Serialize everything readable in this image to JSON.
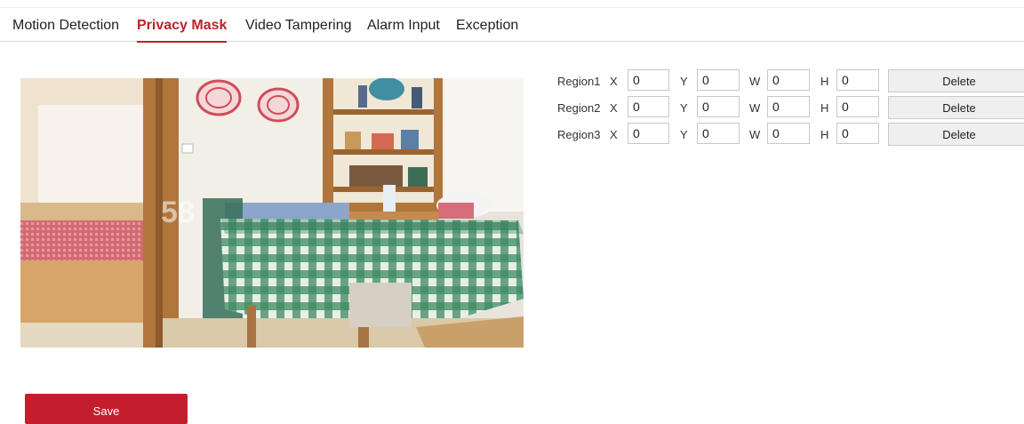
{
  "tabs": [
    {
      "label": "Motion Detection",
      "active": false
    },
    {
      "label": "Privacy Mask",
      "active": true
    },
    {
      "label": "Video Tampering",
      "active": false
    },
    {
      "label": "Alarm Input",
      "active": false
    },
    {
      "label": "Exception",
      "active": false
    }
  ],
  "preview": {
    "watermark": "58",
    "colors": {
      "wall": "#f2efe6",
      "wood": "#b0763c",
      "tablecloth_green": "#2f7a55",
      "floor": "#d9c9a8"
    }
  },
  "regions": [
    {
      "label": "Region1",
      "x_label": "X",
      "x": "0",
      "y_label": "Y",
      "y": "0",
      "w_label": "W",
      "w": "0",
      "h_label": "H",
      "h": "0",
      "delete_label": "Delete"
    },
    {
      "label": "Region2",
      "x_label": "X",
      "x": "0",
      "y_label": "Y",
      "y": "0",
      "w_label": "W",
      "w": "0",
      "h_label": "H",
      "h": "0",
      "delete_label": "Delete"
    },
    {
      "label": "Region3",
      "x_label": "X",
      "x": "0",
      "y_label": "Y",
      "y": "0",
      "w_label": "W",
      "w": "0",
      "h_label": "H",
      "h": "0",
      "delete_label": "Delete"
    }
  ],
  "save_label": "Save",
  "colors": {
    "accent": "#c41e2e",
    "active_tab": "#c0202d"
  }
}
